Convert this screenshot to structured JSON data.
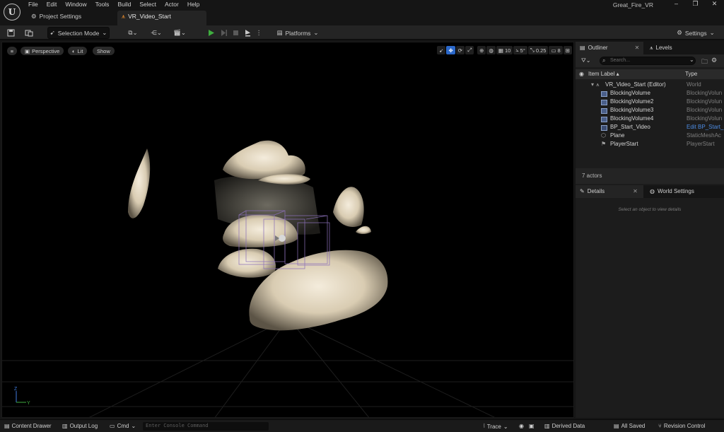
{
  "menu": [
    "File",
    "Edit",
    "Window",
    "Tools",
    "Build",
    "Select",
    "Actor",
    "Help"
  ],
  "app_title": "Great_Fire_VR",
  "tabs": {
    "project_settings": "Project Settings",
    "level": "VR_Video_Start"
  },
  "toolbar": {
    "mode": "Selection Mode",
    "platforms": "Platforms",
    "settings": "Settings"
  },
  "viewport": {
    "perspective": "Perspective",
    "lit": "Lit",
    "show": "Show",
    "grid_snap": "10",
    "rotation_snap": "5°",
    "scale_snap": "0.25",
    "camera_speed": "8"
  },
  "outliner": {
    "tab": "Outliner",
    "levels_tab": "Levels",
    "search_placeholder": "Search...",
    "col_label": "Item Label ▴",
    "col_type": "Type",
    "root": {
      "label": "VR_Video_Start (Editor)",
      "type": "World"
    },
    "items": [
      {
        "label": "BlockingVolume",
        "type": "BlockingVolun",
        "icon": "volume-icon"
      },
      {
        "label": "BlockingVolume2",
        "type": "BlockingVolun",
        "icon": "volume-icon"
      },
      {
        "label": "BlockingVolume3",
        "type": "BlockingVolun",
        "icon": "volume-icon"
      },
      {
        "label": "BlockingVolume4",
        "type": "BlockingVolun",
        "icon": "volume-icon"
      },
      {
        "label": "BP_Start_Video",
        "type": "Edit BP_Start_",
        "icon": "blueprint-icon"
      },
      {
        "label": "Plane",
        "type": "StaticMeshAc",
        "icon": "mesh-icon"
      },
      {
        "label": "PlayerStart",
        "type": "PlayerStart",
        "icon": "flag-icon"
      }
    ],
    "actor_count": "7 actors"
  },
  "details": {
    "tab": "Details",
    "world_settings_tab": "World Settings",
    "empty_text": "Select an object to view details"
  },
  "statusbar": {
    "content_drawer": "Content Drawer",
    "output_log": "Output Log",
    "cmd": "Cmd",
    "console_placeholder": "Enter Console Command",
    "trace": "Trace",
    "derived_data": "Derived Data",
    "all_saved": "All Saved",
    "revision_control": "Revision Control"
  },
  "colors": {
    "accent": "#2b68c9",
    "play": "#3fae3f",
    "link": "#4c8be2",
    "level_icon": "#e58a2c"
  }
}
